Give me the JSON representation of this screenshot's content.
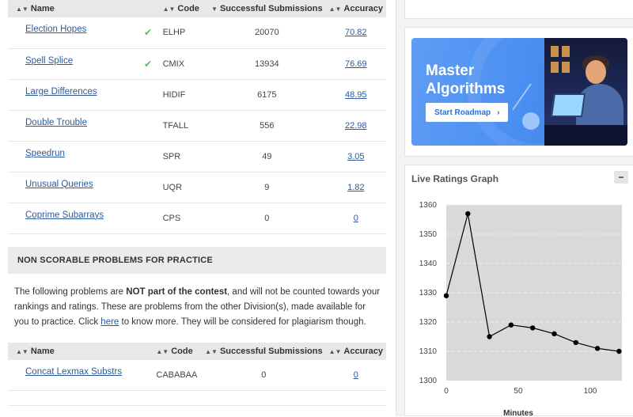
{
  "problems": {
    "headers": {
      "name": "Name",
      "code": "Code",
      "subs": "Successful Submissions",
      "acc": "Accuracy"
    },
    "rows": [
      {
        "name": "Election Hopes",
        "solved": true,
        "code": "ELHP",
        "subs": "20070",
        "acc": "70.82"
      },
      {
        "name": "Spell Splice",
        "solved": true,
        "code": "CMIX",
        "subs": "13934",
        "acc": "76.69"
      },
      {
        "name": "Large Differences",
        "solved": false,
        "code": "HIDIF",
        "subs": "6175",
        "acc": "48.95"
      },
      {
        "name": "Double Trouble",
        "solved": false,
        "code": "TFALL",
        "subs": "556",
        "acc": "22.98"
      },
      {
        "name": "Speedrun",
        "solved": false,
        "code": "SPR",
        "subs": "49",
        "acc": "3.05"
      },
      {
        "name": "Unusual Queries",
        "solved": false,
        "code": "UQR",
        "subs": "9",
        "acc": "1.82"
      },
      {
        "name": "Coprime Subarrays",
        "solved": false,
        "code": "CPS",
        "subs": "0",
        "acc": "0"
      }
    ]
  },
  "practice": {
    "heading": "NON SCORABLE PROBLEMS FOR PRACTICE",
    "text_before": "The following problems are ",
    "text_bold": "NOT part of the contest",
    "text_after": ", and will not be counted towards your rankings and ratings. These are problems from the other Division(s), made available for you to practice. Click ",
    "link": "here",
    "text_end": " to know more. They will be considered for plagiarism though.",
    "headers": {
      "name": "Name",
      "code": "Code",
      "subs": "Successful Submissions",
      "acc": "Accuracy"
    },
    "rows": [
      {
        "name": "Concat Lexmax Substrs",
        "code": "CABABAA",
        "subs": "0",
        "acc": "0"
      }
    ]
  },
  "banner": {
    "title": "Master Algorithms",
    "button": "Start Roadmap",
    "button_icon": "chevron-right-icon",
    "color": "#4c8ff2"
  },
  "graph": {
    "title": "Live Ratings Graph",
    "minimize": "−",
    "chart_data": {
      "type": "line",
      "x": [
        0,
        15,
        30,
        45,
        60,
        75,
        90,
        105,
        120
      ],
      "y": [
        1329,
        1357,
        1315,
        1319,
        1318,
        1316,
        1313,
        1311,
        1310
      ],
      "xlabel": "Minutes",
      "ylabel": "",
      "xticks": [
        0,
        50,
        100
      ],
      "yticks": [
        1300,
        1310,
        1320,
        1330,
        1340,
        1350,
        1360
      ],
      "xlim": [
        0,
        122
      ],
      "ylim": [
        1300,
        1360
      ],
      "grid": true,
      "colors": {
        "line": "#000000",
        "plot_bg": "#d9d9d9"
      }
    }
  }
}
